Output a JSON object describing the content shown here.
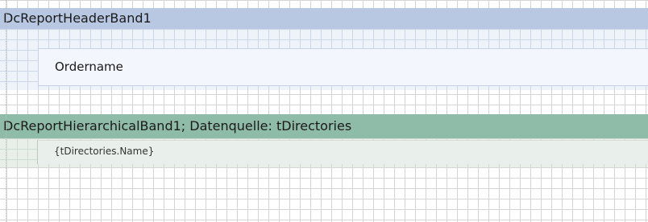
{
  "header_band": {
    "title": "DcReportHeaderBand1",
    "field_text": "Ordername",
    "color": "#b9c8e2"
  },
  "hierarchical_band": {
    "title": "DcReportHierarchicalBand1;  Datenquelle:  tDirectories",
    "field_text": "{tDirectories.Name}",
    "color": "#8fbca8"
  }
}
